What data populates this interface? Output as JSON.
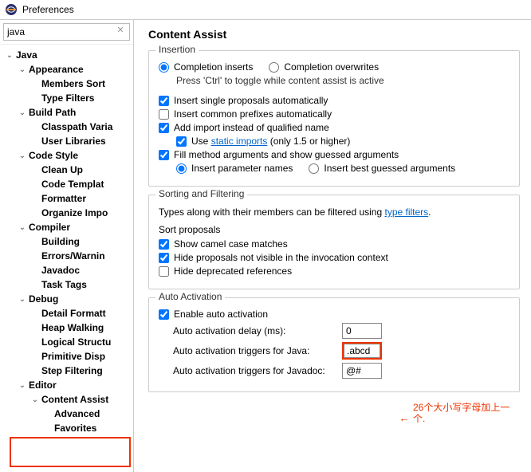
{
  "window": {
    "title": "Preferences"
  },
  "search": {
    "value": "java"
  },
  "tree": {
    "items": [
      {
        "label": "Java",
        "indent": 0,
        "twisty": "v",
        "bold": true
      },
      {
        "label": "Appearance",
        "indent": 1,
        "twisty": "v",
        "bold": true
      },
      {
        "label": "Members Sort",
        "indent": 2,
        "twisty": "",
        "bold": true
      },
      {
        "label": "Type Filters",
        "indent": 2,
        "twisty": "",
        "bold": true
      },
      {
        "label": "Build Path",
        "indent": 1,
        "twisty": "v",
        "bold": true
      },
      {
        "label": "Classpath Varia",
        "indent": 2,
        "twisty": "",
        "bold": true
      },
      {
        "label": "User Libraries",
        "indent": 2,
        "twisty": "",
        "bold": true
      },
      {
        "label": "Code Style",
        "indent": 1,
        "twisty": "v",
        "bold": true
      },
      {
        "label": "Clean Up",
        "indent": 2,
        "twisty": "",
        "bold": true
      },
      {
        "label": "Code Templat",
        "indent": 2,
        "twisty": "",
        "bold": true
      },
      {
        "label": "Formatter",
        "indent": 2,
        "twisty": "",
        "bold": true
      },
      {
        "label": "Organize Impo",
        "indent": 2,
        "twisty": "",
        "bold": true
      },
      {
        "label": "Compiler",
        "indent": 1,
        "twisty": "v",
        "bold": true
      },
      {
        "label": "Building",
        "indent": 2,
        "twisty": "",
        "bold": true
      },
      {
        "label": "Errors/Warnin",
        "indent": 2,
        "twisty": "",
        "bold": true
      },
      {
        "label": "Javadoc",
        "indent": 2,
        "twisty": "",
        "bold": true
      },
      {
        "label": "Task Tags",
        "indent": 2,
        "twisty": "",
        "bold": true
      },
      {
        "label": "Debug",
        "indent": 1,
        "twisty": "v",
        "bold": true
      },
      {
        "label": "Detail Formatt",
        "indent": 2,
        "twisty": "",
        "bold": true
      },
      {
        "label": "Heap Walking",
        "indent": 2,
        "twisty": "",
        "bold": true
      },
      {
        "label": "Logical Structu",
        "indent": 2,
        "twisty": "",
        "bold": true
      },
      {
        "label": "Primitive Disp",
        "indent": 2,
        "twisty": "",
        "bold": true
      },
      {
        "label": "Step Filtering",
        "indent": 2,
        "twisty": "",
        "bold": true
      },
      {
        "label": "Editor",
        "indent": 1,
        "twisty": "v",
        "bold": true
      },
      {
        "label": "Content Assist",
        "indent": 2,
        "twisty": "v",
        "bold": true
      },
      {
        "label": "Advanced",
        "indent": 3,
        "twisty": "",
        "bold": true
      },
      {
        "label": "Favorites",
        "indent": 3,
        "twisty": "",
        "bold": true
      }
    ]
  },
  "page": {
    "title": "Content Assist",
    "insertion": {
      "group_title": "Insertion",
      "completion_inserts": "Completion inserts",
      "completion_overwrites": "Completion overwrites",
      "hint": "Press 'Ctrl' to toggle while content assist is active",
      "insert_single": "Insert single proposals automatically",
      "insert_prefixes": "Insert common prefixes automatically",
      "add_import": "Add import instead of qualified name",
      "use_static_pre": "Use ",
      "use_static_link": "static imports",
      "use_static_post": " (only 1.5 or higher)",
      "fill_args": "Fill method arguments and show guessed arguments",
      "insert_param": "Insert parameter names",
      "insert_best": "Insert best guessed arguments"
    },
    "sorting": {
      "group_title": "Sorting and Filtering",
      "desc_pre": "Types along with their members can be filtered using ",
      "desc_link": "type filters",
      "desc_post": ".",
      "sort_proposals": "Sort proposals",
      "camel": "Show camel case matches",
      "hide_not_visible": "Hide proposals not visible in the invocation context",
      "hide_deprecated": "Hide deprecated references"
    },
    "auto": {
      "group_title": "Auto Activation",
      "enable": "Enable auto activation",
      "delay_label": "Auto activation delay (ms):",
      "delay_value": "0",
      "java_label": "Auto activation triggers for Java:",
      "java_value": ".abcd",
      "javadoc_label": "Auto activation triggers for Javadoc:",
      "javadoc_value": "@#"
    }
  },
  "annotation": {
    "text": "26个大小写字母加上一个.",
    "arrow": "←"
  }
}
